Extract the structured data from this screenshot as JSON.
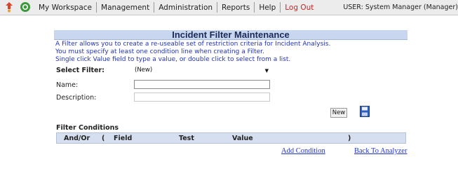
{
  "topbar": {
    "menu": [
      "My Workspace",
      "Management",
      "Administration",
      "Reports",
      "Help",
      "Log Out"
    ],
    "user": "USER: System Manager (Manager)"
  },
  "page": {
    "title": "Incident Filter Maintenance",
    "info": [
      "A Filter allows you to create a re-useable set of restriction criteria for Incident Analysis.",
      "You must specify at least one condition line when creating a Filter.",
      "Single click Value field to type a value, or double click to select from a list."
    ]
  },
  "form": {
    "select_filter_label": "Select Filter:",
    "select_filter_value": "(New)",
    "name_label": "Name:",
    "name_value": "",
    "description_label": "Description:",
    "description_value": "",
    "new_button": "New"
  },
  "conditions": {
    "title": "Filter Conditions",
    "columns": [
      "And/Or",
      "(",
      "Field",
      "Test",
      "Value",
      ")"
    ],
    "add_condition": "Add Condition",
    "back": "Back To Analyzer"
  },
  "colors": {
    "title_bg": "#c9d6f0",
    "info_text": "#2233bb",
    "logout": "#cc2222",
    "link": "#2233cc"
  }
}
